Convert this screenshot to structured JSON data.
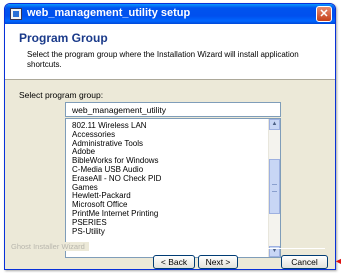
{
  "window": {
    "title": "web_management_utility setup",
    "close_glyph": "✕"
  },
  "header": {
    "title": "Program Group",
    "description": "Select the program group where the Installation Wizard will install application shortcuts."
  },
  "form": {
    "label": "Select program group:",
    "input_value": "web_management_utility"
  },
  "program_groups": [
    "802.11 Wireless LAN",
    "Accessories",
    "Administrative Tools",
    "Adobe",
    "BibleWorks for Windows",
    "C-Media USB Audio",
    "EraseAll - NO Check PID",
    "Games",
    "Hewlett-Packard",
    "Microsoft Office",
    "PrintMe Internet Printing",
    "PSERIES",
    "PS-Utility"
  ],
  "footer": {
    "group_label": "Ghost Installer Wizard",
    "back_label": "< Back",
    "next_label": "Next >",
    "cancel_label": "Cancel"
  }
}
